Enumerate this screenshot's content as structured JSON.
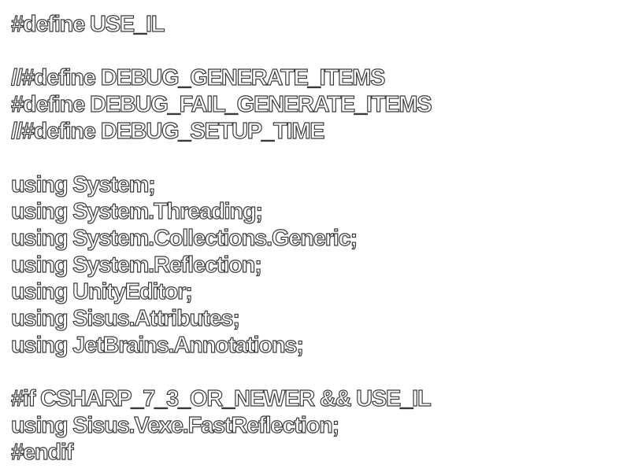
{
  "editor": {
    "lines": [
      "#define USE_IL",
      "",
      "//#define DEBUG_GENERATE_ITEMS",
      "#define DEBUG_FAIL_GENERATE_ITEMS",
      "//#define DEBUG_SETUP_TIME",
      "",
      "using System;",
      "using System.Threading;",
      "using System.Collections.Generic;",
      "using System.Reflection;",
      "using UnityEditor;",
      "using Sisus.Attributes;",
      "using JetBrains.Annotations;",
      "",
      "#if CSHARP_7_3_OR_NEWER && USE_IL",
      "using Sisus.Vexe.FastReflection;",
      "#endif"
    ]
  },
  "colors": {
    "background": "#ffffff",
    "text_fill": "#ffffff",
    "text_outline": "#3a3a3a"
  }
}
